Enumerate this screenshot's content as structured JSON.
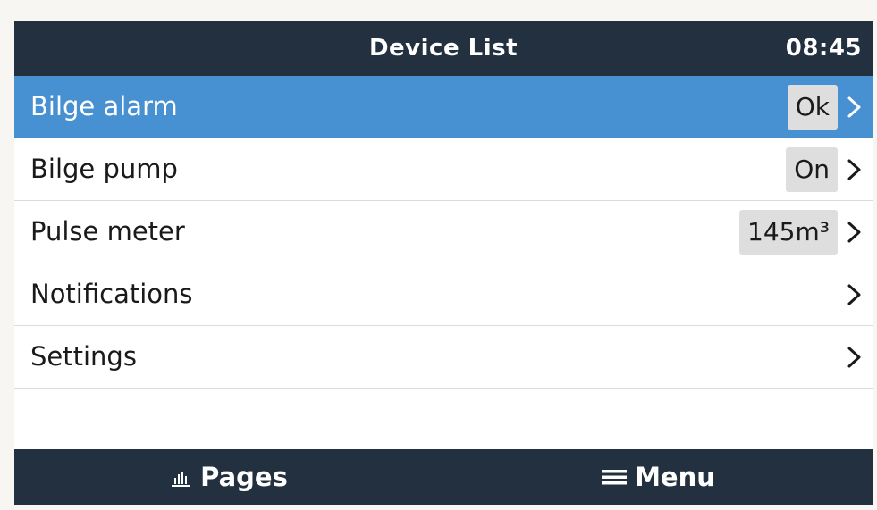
{
  "header": {
    "title": "Device List",
    "clock": "08:45"
  },
  "rows": [
    {
      "label": "Bilge alarm",
      "value": "Ok",
      "selected": true
    },
    {
      "label": "Bilge pump",
      "value": "On",
      "selected": false
    },
    {
      "label": "Pulse meter",
      "value": "145m³",
      "selected": false
    },
    {
      "label": "Notifications",
      "value": "",
      "selected": false
    },
    {
      "label": "Settings",
      "value": "",
      "selected": false
    }
  ],
  "footer": {
    "pages_label": "Pages",
    "pages_icon": "bar-chart-icon",
    "menu_label": "Menu",
    "menu_icon": "hamburger-menu-icon"
  },
  "colors": {
    "bar": "#233040",
    "selection": "#4790d1",
    "value_box": "#dedede"
  }
}
